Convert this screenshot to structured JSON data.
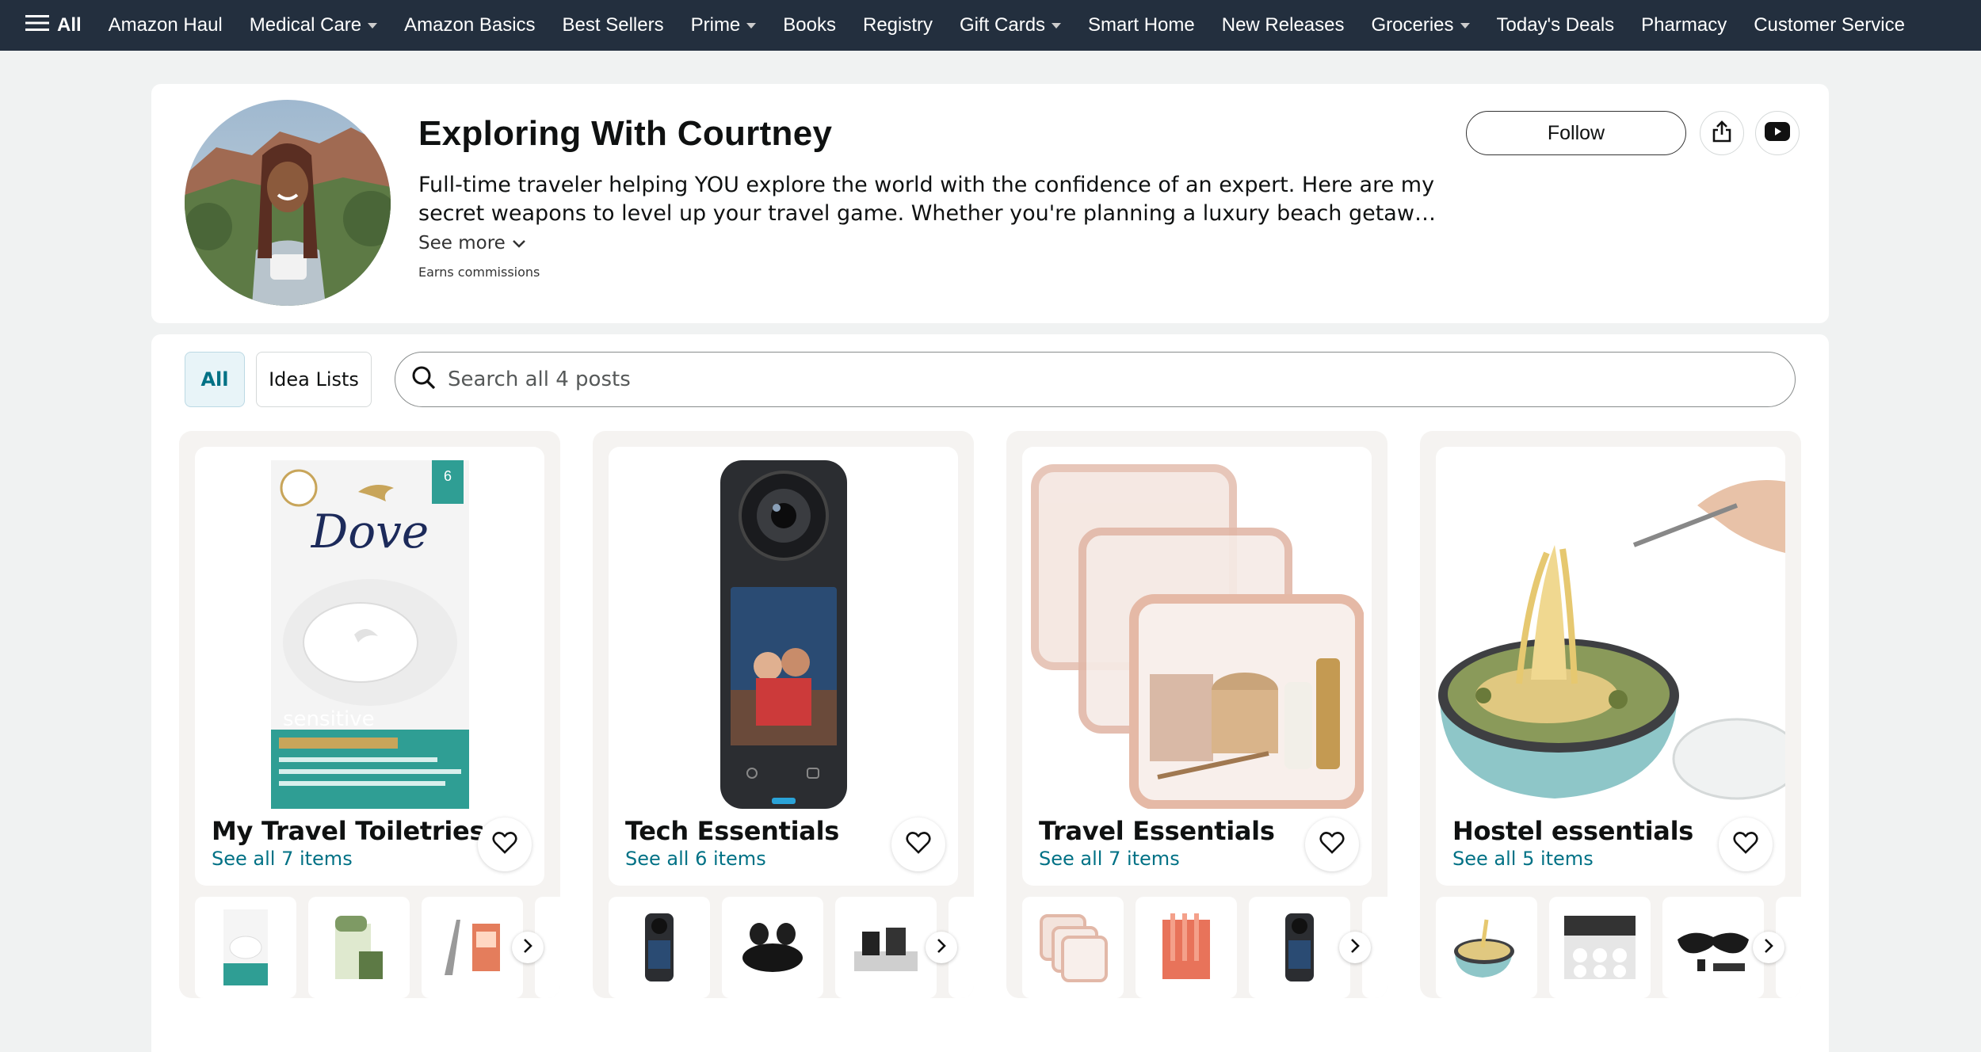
{
  "nav": {
    "all_label": "All",
    "items": [
      {
        "label": "Amazon Haul",
        "dropdown": false
      },
      {
        "label": "Medical Care",
        "dropdown": true
      },
      {
        "label": "Amazon Basics",
        "dropdown": false
      },
      {
        "label": "Best Sellers",
        "dropdown": false
      },
      {
        "label": "Prime",
        "dropdown": true
      },
      {
        "label": "Books",
        "dropdown": false
      },
      {
        "label": "Registry",
        "dropdown": false
      },
      {
        "label": "Gift Cards",
        "dropdown": true
      },
      {
        "label": "Smart Home",
        "dropdown": false
      },
      {
        "label": "New Releases",
        "dropdown": false
      },
      {
        "label": "Groceries",
        "dropdown": true
      },
      {
        "label": "Today's Deals",
        "dropdown": false
      },
      {
        "label": "Pharmacy",
        "dropdown": false
      },
      {
        "label": "Customer Service",
        "dropdown": false
      }
    ]
  },
  "profile": {
    "name": "Exploring With Courtney",
    "bio": "Full-time traveler helping YOU explore the world with the confidence of an expert. Here are my secret weapons to level up your travel game. Whether you're planning a luxury beach getaway or a budget-friendly…",
    "see_more": "See more",
    "earns": "Earns commissions",
    "follow_label": "Follow"
  },
  "filters": {
    "all": "All",
    "idea_lists": "Idea Lists"
  },
  "search": {
    "placeholder": "Search all 4 posts"
  },
  "lists": [
    {
      "title": "My Travel Toiletries",
      "count": "See all 7 items"
    },
    {
      "title": "Tech Essentials",
      "count": "See all 6 items"
    },
    {
      "title": "Travel Essentials",
      "count": "See all 7 items"
    },
    {
      "title": "Hostel essentials",
      "count": "See all 5 items"
    }
  ],
  "product_art": {
    "dove_brand": "Dove",
    "dove_variant": "sensitive",
    "dove_bars": "6"
  },
  "colors": {
    "nav_bg": "#232f3e",
    "link_teal": "#007185",
    "page_bg": "#f0f2f2"
  }
}
